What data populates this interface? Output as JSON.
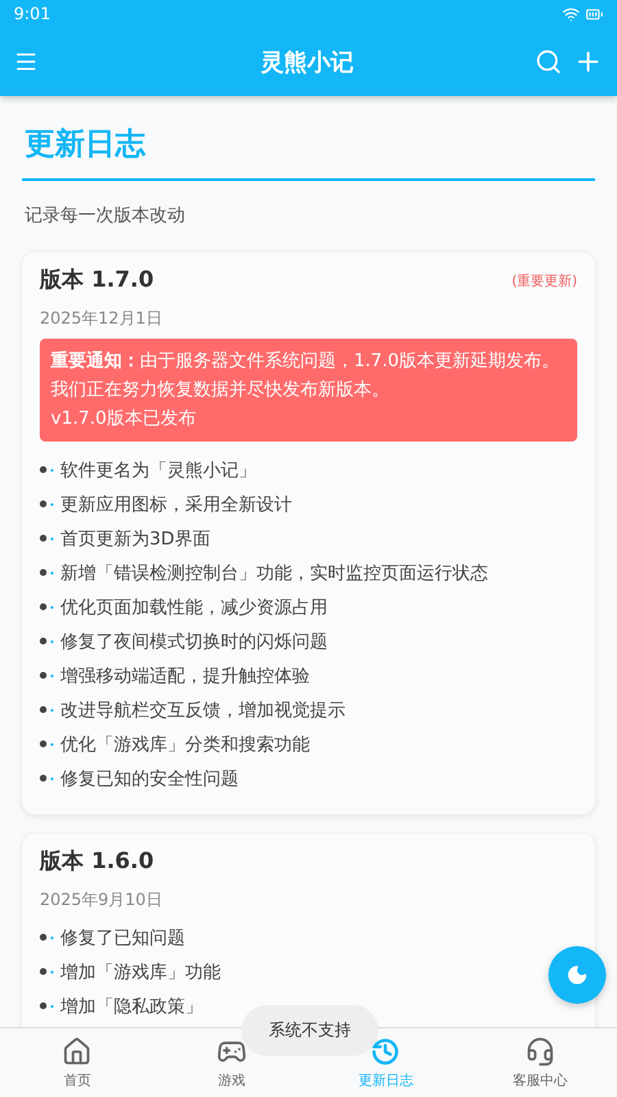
{
  "status_bar": {
    "time": "9:01"
  },
  "app_bar": {
    "title": "灵熊小记"
  },
  "page": {
    "title": "更新日志",
    "subtitle": "记录每一次版本改动"
  },
  "versions": [
    {
      "title": "版本 1.7.0",
      "badge": "(重要更新)",
      "date": "2025年12月1日",
      "notice": [
        "**重要通知：**由于服务器文件系统问题，1.7.0版本更新延期发布。我们正在努力恢复数据并尽快发布新版本。",
        "v1.7.0版本已发布"
      ],
      "items": [
        "软件更名为「灵熊小记」",
        "更新应用图标，采用全新设计",
        "首页更新为3D界面",
        "新增「错误检测控制台」功能，实时监控页面运行状态",
        "优化页面加载性能，减少资源占用",
        "修复了夜间模式切换时的闪烁问题",
        "增强移动端适配，提升触控体验",
        "改进导航栏交互反馈，增加视觉提示",
        "优化「游戏库」分类和搜索功能",
        "修复已知的安全性问题"
      ]
    },
    {
      "title": "版本 1.6.0",
      "date": "2025年9月10日",
      "items": [
        "修复了已知问题",
        "增加「游戏库」功能",
        "增加「隐私政策」"
      ]
    }
  ],
  "toast": "系统不支持",
  "tabs": [
    {
      "label": "首页",
      "kind": "home",
      "selected": false
    },
    {
      "label": "游戏",
      "kind": "game",
      "selected": false
    },
    {
      "label": "更新日志",
      "kind": "history",
      "selected": true
    },
    {
      "label": "客服中心",
      "kind": "support",
      "selected": false
    }
  ]
}
